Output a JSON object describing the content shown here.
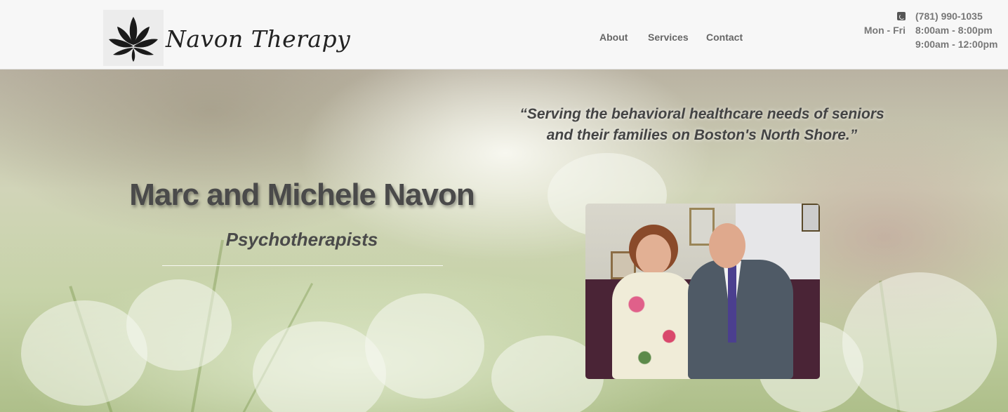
{
  "header": {
    "brand_name": "Navon Therapy",
    "logo_icon": "lotus-icon",
    "nav": [
      {
        "label": "About"
      },
      {
        "label": "Services"
      },
      {
        "label": "Contact"
      }
    ],
    "contact": {
      "phone_icon": "phone-icon",
      "phone": "(781) 990-1035",
      "hours": [
        {
          "days": "Mon - Fri",
          "time": "8:00am - 8:00pm"
        },
        {
          "days": "",
          "time": "9:00am - 12:00pm"
        }
      ]
    }
  },
  "hero": {
    "quote_line1": "“Serving the behavioral healthcare needs of seniors",
    "quote_line2": "and their families on Boston's North Shore.”",
    "title": "Marc and Michele Navon",
    "subtitle": "Psychotherapists"
  },
  "colors": {
    "header_bg": "#f7f7f7",
    "nav_text": "#666666",
    "heading_text": "#4a4a4a"
  }
}
